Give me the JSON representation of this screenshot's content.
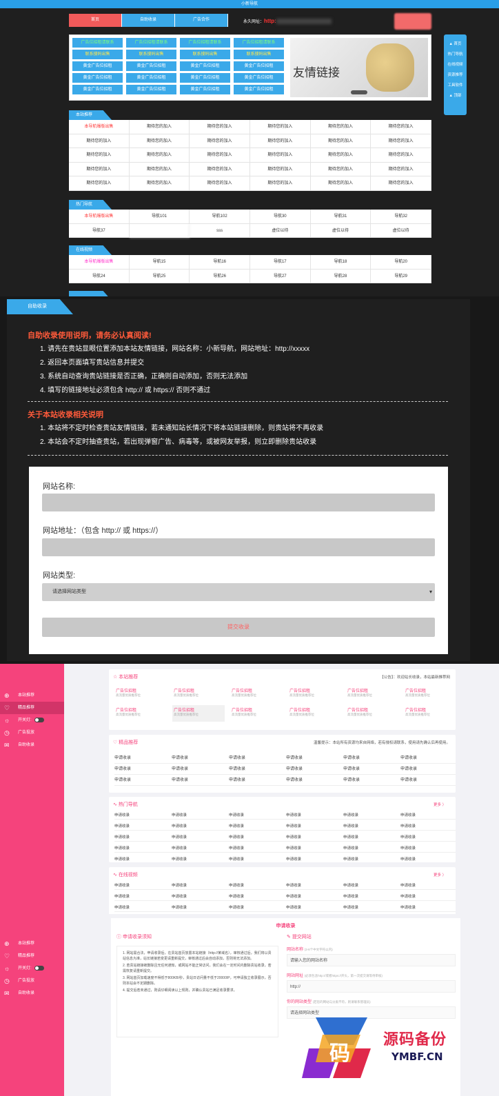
{
  "s1": {
    "site_title": "小新导航",
    "nav": [
      "首页",
      "自助收录",
      "广告合作"
    ],
    "perm_label": "永久网址：",
    "perm_url": "http:",
    "ad_rows": [
      [
        {
          "t": "广告位招租请联系",
          "c": "g"
        },
        {
          "t": "广告位招租请联系",
          "c": "g"
        },
        {
          "t": "广告位招租请联系",
          "c": "g"
        },
        {
          "t": "广告位招租请联系",
          "c": "g"
        }
      ],
      [
        {
          "t": "联系搜码出售",
          "c": "y"
        },
        {
          "t": "联系搜码出售",
          "c": "y"
        },
        {
          "t": "联系搜码出售",
          "c": "y"
        },
        {
          "t": "联系搜码出售",
          "c": "y"
        }
      ],
      [
        {
          "t": "黄金广告位招租",
          "c": "w"
        },
        {
          "t": "黄金广告位招租",
          "c": "w"
        },
        {
          "t": "黄金广告位招租",
          "c": "w"
        },
        {
          "t": "黄金广告位招租",
          "c": "w"
        }
      ],
      [
        {
          "t": "黄金广告位招租",
          "c": "w"
        },
        {
          "t": "黄金广告位招租",
          "c": "w"
        },
        {
          "t": "黄金广告位招租",
          "c": "w"
        },
        {
          "t": "黄金广告位招租",
          "c": "w"
        }
      ],
      [
        {
          "t": "黄金广告位招租",
          "c": "w"
        },
        {
          "t": "黄金广告位招租",
          "c": "w"
        },
        {
          "t": "黄金广告位招租",
          "c": "w"
        },
        {
          "t": "黄金广告位招租",
          "c": "w"
        }
      ]
    ],
    "friend_text": "友情链接",
    "sidenav": [
      "▲ 首页",
      "热门导航",
      "在线视频",
      "资源推荐",
      "工具软件",
      "▲ 顶部"
    ],
    "sec_recommend": "本站推荐",
    "recommend": [
      [
        "本导航爆版出售",
        "期待您的加入",
        "期待您的加入",
        "期待您的加入",
        "期待您的加入",
        "期待您的加入"
      ],
      [
        "期待您的加入",
        "期待您的加入",
        "期待您的加入",
        "期待您的加入",
        "期待您的加入",
        "期待您的加入"
      ],
      [
        "期待您的加入",
        "期待您的加入",
        "期待您的加入",
        "期待您的加入",
        "期待您的加入",
        "期待您的加入"
      ],
      [
        "期待您的加入",
        "期待您的加入",
        "期待您的加入",
        "期待您的加入",
        "期待您的加入",
        "期待您的加入"
      ],
      [
        "期待您的加入",
        "期待您的加入",
        "期待您的加入",
        "期待您的加入",
        "期待您的加入",
        "期待您的加入"
      ]
    ],
    "sec_hot": "热门导航",
    "hot": [
      [
        "本导航爆版出售",
        "导航101",
        "导航102",
        "导航30",
        "导航31",
        "导航32"
      ],
      [
        "导航37",
        "",
        "sss",
        "虚位以待",
        "虚位以待",
        "虚位以待"
      ]
    ],
    "sec_video": "在线视频",
    "video": [
      [
        "本导航爆版出售",
        "导航15",
        "导航16",
        "导航17",
        "导航18",
        "导航20"
      ],
      [
        "导航24",
        "导航25",
        "导航26",
        "导航27",
        "导航28",
        "导航29"
      ]
    ]
  },
  "s2": {
    "tab": "自助收录",
    "h1": "自助收录使用说明，请务必认真阅读!",
    "rules1": [
      "1. 请先在贵站显眼位置添加本站友情链接，网站名称：小新导航，网站地址：http://xxxxx",
      "2. 返回本页面填写贵站信息并提交",
      "3. 系统自动查询贵站链接是否正确，正确则自动添加，否则无法添加",
      "4. 填写的链接地址必须包含 http:// 或 https:// 否则不通过"
    ],
    "h2": "关于本站收录相关说明",
    "rules2": [
      "1. 本站将不定时检查贵站友情链接，若未通知站长情况下将本站链接删除，则贵站将不再收录",
      "2. 本站会不定时抽查贵站，若出现弹窗广告、病毒等，或被网友举报，则立即删除贵站收录"
    ],
    "f_name": "网站名称:",
    "f_url": "网站地址：（包含 http:// 或 https://）",
    "f_type": "网站类型:",
    "f_select": "请选择网站类型",
    "f_submit": "提交收录"
  },
  "s3": {
    "side": [
      {
        "ic": "⊕",
        "t": "本站推荐"
      },
      {
        "ic": "♡",
        "t": "精品推荐"
      },
      {
        "ic": "☼",
        "t": "开关灯:"
      },
      {
        "ic": "◷",
        "t": "广告投放"
      },
      {
        "ic": "✉",
        "t": "自助收录"
      }
    ],
    "card1_title": "本站推荐",
    "card1_note": "【公告】：欢迎站长收录，本站最新推荐网",
    "ads": [
      {
        "t": "广告位招租",
        "s": "高流量优质推荐位"
      },
      {
        "t": "广告位招租",
        "s": "高流量优质推荐位"
      },
      {
        "t": "广告位招租",
        "s": "高流量优质推荐位"
      },
      {
        "t": "广告位招租",
        "s": "高流量优质推荐位"
      },
      {
        "t": "广告位招租",
        "s": "高流量优质推荐位"
      },
      {
        "t": "广告位招租",
        "s": "高流量优质推荐位"
      },
      {
        "t": "广告位招租",
        "s": "高流量优质推荐位"
      },
      {
        "t": "广告位招租",
        "s": "高流量优质推荐位"
      },
      {
        "t": "广告位招租",
        "s": "高流量优质推荐位"
      },
      {
        "t": "广告位招租",
        "s": "高流量优质推荐位"
      },
      {
        "t": "广告位招租",
        "s": "高流量优质推荐位"
      },
      {
        "t": "广告位招租",
        "s": "高流量优质推荐位"
      }
    ],
    "card2_title": "精品推荐",
    "card2_note": "温馨提示：本站所有资源均来自网络，若有侵权请联系，使用请先确认后再使用。",
    "apply": "申请收录",
    "card3_title": "热门导航",
    "card4_title": "在线视频",
    "more": "更多 〉"
  },
  "s4": {
    "title": "申请收录",
    "left_h": "申请收录须知",
    "notes": [
      "1. 网站需合法，申请收录后，在贵站首页放置本站链接（http://某域名），审核通过后，我们将以贵站信息为准，站长链接若变更请重新提交，审核通过后会自动添加，否则将无法添加。",
      "2. 若贵站链接被删除且无任何通知，或网站不能正常访问，我们会在一定时间内删除贵站收录，若需恢复请重新提交。",
      "3. 网站首页加载速度不得低于800KB/秒，贵站日访问量不低于20000IP，可申请独立收录展示，否则本站会不定期删除。",
      "4. 提交后若未通过，则请仔细阅读以上规则，并确认贵站已满足收录要求。"
    ],
    "right_h": "提交网站",
    "r_name": "网站名称",
    "r_name_hint": "(3-8个中文字符以内)",
    "r_name_ph": "请输入您的网站名称",
    "r_url": "网站网址",
    "r_url_hint": "(必须包含http://或者https://开头，第一次提交请等待审核)",
    "r_url_val": "http://",
    "r_type": "你的网站类型",
    "r_type_hint": "(若您的网站与分类不符，则请联系管理员)",
    "r_type_val": "请选择网站类型"
  },
  "watermark": {
    "cn": "源码备份",
    "en": "YMBF.CN"
  }
}
